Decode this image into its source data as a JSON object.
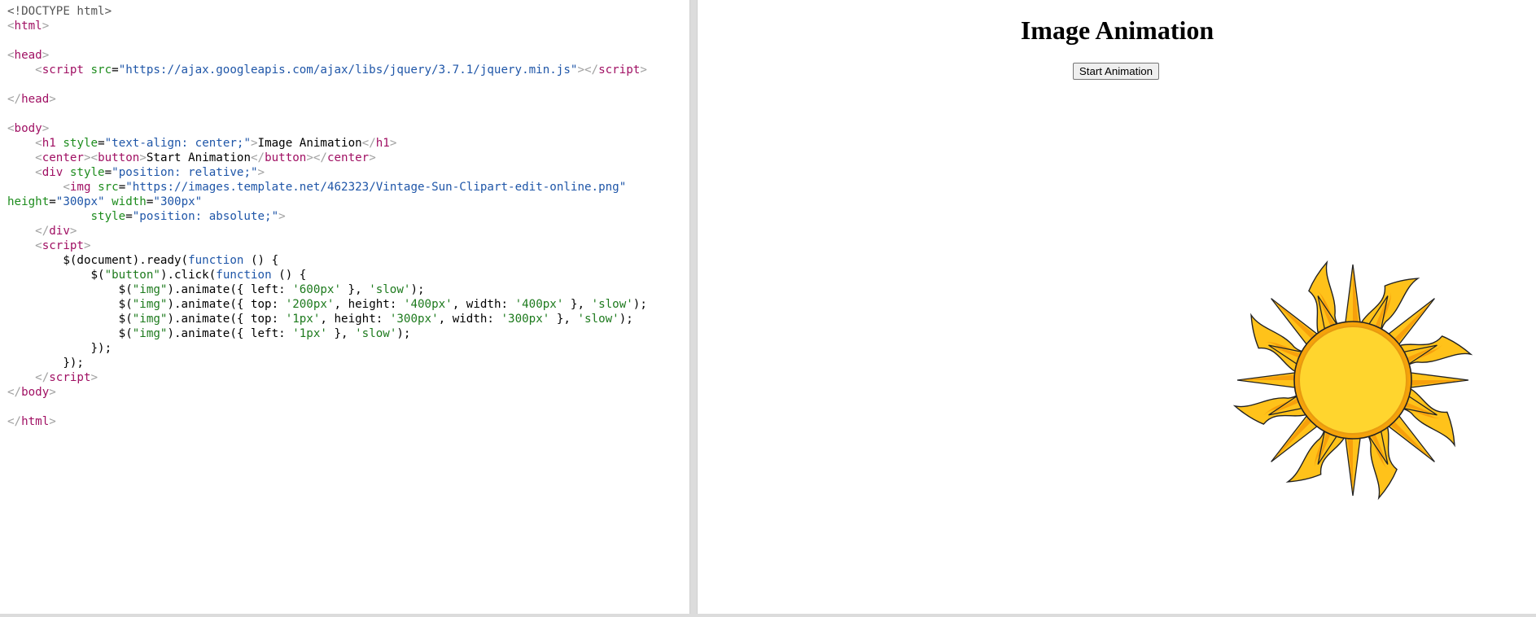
{
  "editor": {
    "lines": [
      [
        [
          "t-doctype",
          "<!DOCTYPE html>"
        ]
      ],
      [
        [
          "t-punct",
          "<"
        ],
        [
          "t-tag",
          "html"
        ],
        [
          "t-punct",
          ">"
        ]
      ],
      [],
      [
        [
          "t-punct",
          "<"
        ],
        [
          "t-tag",
          "head"
        ],
        [
          "t-punct",
          ">"
        ]
      ],
      [
        [
          "t-text",
          "    "
        ],
        [
          "t-punct",
          "<"
        ],
        [
          "t-tag",
          "script"
        ],
        [
          "t-text",
          " "
        ],
        [
          "t-attr",
          "src"
        ],
        [
          "t-text",
          "="
        ],
        [
          "t-str",
          "\"https://ajax.googleapis.com/ajax/libs/jquery/3.7.1/jquery.min.js\""
        ],
        [
          "t-punct",
          "></"
        ],
        [
          "t-tag",
          "script"
        ],
        [
          "t-punct",
          ">"
        ]
      ],
      [],
      [
        [
          "t-punct",
          "</"
        ],
        [
          "t-tag",
          "head"
        ],
        [
          "t-punct",
          ">"
        ]
      ],
      [],
      [
        [
          "t-punct",
          "<"
        ],
        [
          "t-tag",
          "body"
        ],
        [
          "t-punct",
          ">"
        ]
      ],
      [
        [
          "t-text",
          "    "
        ],
        [
          "t-punct",
          "<"
        ],
        [
          "t-tag",
          "h1"
        ],
        [
          "t-text",
          " "
        ],
        [
          "t-attr",
          "style"
        ],
        [
          "t-text",
          "="
        ],
        [
          "t-str",
          "\"text-align: center;\""
        ],
        [
          "t-punct",
          ">"
        ],
        [
          "t-text",
          "Image Animation"
        ],
        [
          "t-punct",
          "</"
        ],
        [
          "t-tag",
          "h1"
        ],
        [
          "t-punct",
          ">"
        ]
      ],
      [
        [
          "t-text",
          "    "
        ],
        [
          "t-punct",
          "<"
        ],
        [
          "t-tag",
          "center"
        ],
        [
          "t-punct",
          "><"
        ],
        [
          "t-tag",
          "button"
        ],
        [
          "t-punct",
          ">"
        ],
        [
          "t-text",
          "Start Animation"
        ],
        [
          "t-punct",
          "</"
        ],
        [
          "t-tag",
          "button"
        ],
        [
          "t-punct",
          "></"
        ],
        [
          "t-tag",
          "center"
        ],
        [
          "t-punct",
          ">"
        ]
      ],
      [
        [
          "t-text",
          "    "
        ],
        [
          "t-punct",
          "<"
        ],
        [
          "t-tag",
          "div"
        ],
        [
          "t-text",
          " "
        ],
        [
          "t-attr",
          "style"
        ],
        [
          "t-text",
          "="
        ],
        [
          "t-str",
          "\"position: relative;\""
        ],
        [
          "t-punct",
          ">"
        ]
      ],
      [
        [
          "t-text",
          "        "
        ],
        [
          "t-punct",
          "<"
        ],
        [
          "t-tag",
          "img"
        ],
        [
          "t-text",
          " "
        ],
        [
          "t-attr",
          "src"
        ],
        [
          "t-text",
          "="
        ],
        [
          "t-str",
          "\"https://images.template.net/462323/Vintage-Sun-Clipart-edit-online.png\""
        ]
      ],
      [
        [
          "t-attr",
          "height"
        ],
        [
          "t-text",
          "="
        ],
        [
          "t-str",
          "\"300px\""
        ],
        [
          "t-text",
          " "
        ],
        [
          "t-attr",
          "width"
        ],
        [
          "t-text",
          "="
        ],
        [
          "t-str",
          "\"300px\""
        ]
      ],
      [
        [
          "t-text",
          "            "
        ],
        [
          "t-attr",
          "style"
        ],
        [
          "t-text",
          "="
        ],
        [
          "t-str",
          "\"position: absolute;\""
        ],
        [
          "t-punct",
          ">"
        ]
      ],
      [
        [
          "t-text",
          "    "
        ],
        [
          "t-punct",
          "</"
        ],
        [
          "t-tag",
          "div"
        ],
        [
          "t-punct",
          ">"
        ]
      ],
      [
        [
          "t-text",
          "    "
        ],
        [
          "t-punct",
          "<"
        ],
        [
          "t-tag",
          "script"
        ],
        [
          "t-punct",
          ">"
        ]
      ],
      [
        [
          "t-js",
          "        $(document).ready("
        ],
        [
          "t-kw",
          "function"
        ],
        [
          "t-js",
          " () {"
        ]
      ],
      [
        [
          "t-js",
          "            $("
        ],
        [
          "t-jsstr",
          "\"button\""
        ],
        [
          "t-js",
          ").click("
        ],
        [
          "t-kw",
          "function"
        ],
        [
          "t-js",
          " () {"
        ]
      ],
      [
        [
          "t-js",
          "                $("
        ],
        [
          "t-jsstr",
          "\"img\""
        ],
        [
          "t-js",
          ").animate({ left: "
        ],
        [
          "t-jsstr",
          "'600px'"
        ],
        [
          "t-js",
          " }, "
        ],
        [
          "t-jsstr",
          "'slow'"
        ],
        [
          "t-js",
          ");"
        ]
      ],
      [
        [
          "t-js",
          "                $("
        ],
        [
          "t-jsstr",
          "\"img\""
        ],
        [
          "t-js",
          ").animate({ top: "
        ],
        [
          "t-jsstr",
          "'200px'"
        ],
        [
          "t-js",
          ", height: "
        ],
        [
          "t-jsstr",
          "'400px'"
        ],
        [
          "t-js",
          ", width: "
        ],
        [
          "t-jsstr",
          "'400px'"
        ],
        [
          "t-js",
          " }, "
        ],
        [
          "t-jsstr",
          "'slow'"
        ],
        [
          "t-js",
          ");"
        ]
      ],
      [
        [
          "t-js",
          "                $("
        ],
        [
          "t-jsstr",
          "\"img\""
        ],
        [
          "t-js",
          ").animate({ top: "
        ],
        [
          "t-jsstr",
          "'1px'"
        ],
        [
          "t-js",
          ", height: "
        ],
        [
          "t-jsstr",
          "'300px'"
        ],
        [
          "t-js",
          ", width: "
        ],
        [
          "t-jsstr",
          "'300px'"
        ],
        [
          "t-js",
          " }, "
        ],
        [
          "t-jsstr",
          "'slow'"
        ],
        [
          "t-js",
          ");"
        ]
      ],
      [
        [
          "t-js",
          "                $("
        ],
        [
          "t-jsstr",
          "\"img\""
        ],
        [
          "t-js",
          ").animate({ left: "
        ],
        [
          "t-jsstr",
          "'1px'"
        ],
        [
          "t-js",
          " }, "
        ],
        [
          "t-jsstr",
          "'slow'"
        ],
        [
          "t-js",
          ");"
        ]
      ],
      [
        [
          "t-js",
          "            });"
        ]
      ],
      [
        [
          "t-js",
          "        });"
        ]
      ],
      [
        [
          "t-text",
          "    "
        ],
        [
          "t-punct",
          "</"
        ],
        [
          "t-tag",
          "script"
        ],
        [
          "t-punct",
          ">"
        ]
      ],
      [
        [
          "t-punct",
          "</"
        ],
        [
          "t-tag",
          "body"
        ],
        [
          "t-punct",
          ">"
        ]
      ],
      [],
      [
        [
          "t-punct",
          "</"
        ],
        [
          "t-tag",
          "html"
        ],
        [
          "t-punct",
          ">"
        ]
      ]
    ]
  },
  "preview": {
    "title": "Image Animation",
    "button_label": "Start Animation",
    "image_icon": "sun-icon",
    "colors": {
      "sun_core": "#ffd52e",
      "sun_ring": "#f5a20a",
      "ray_fill": "#ffc21a",
      "ray_inner": "#f7a00c",
      "outline": "#222222"
    }
  }
}
